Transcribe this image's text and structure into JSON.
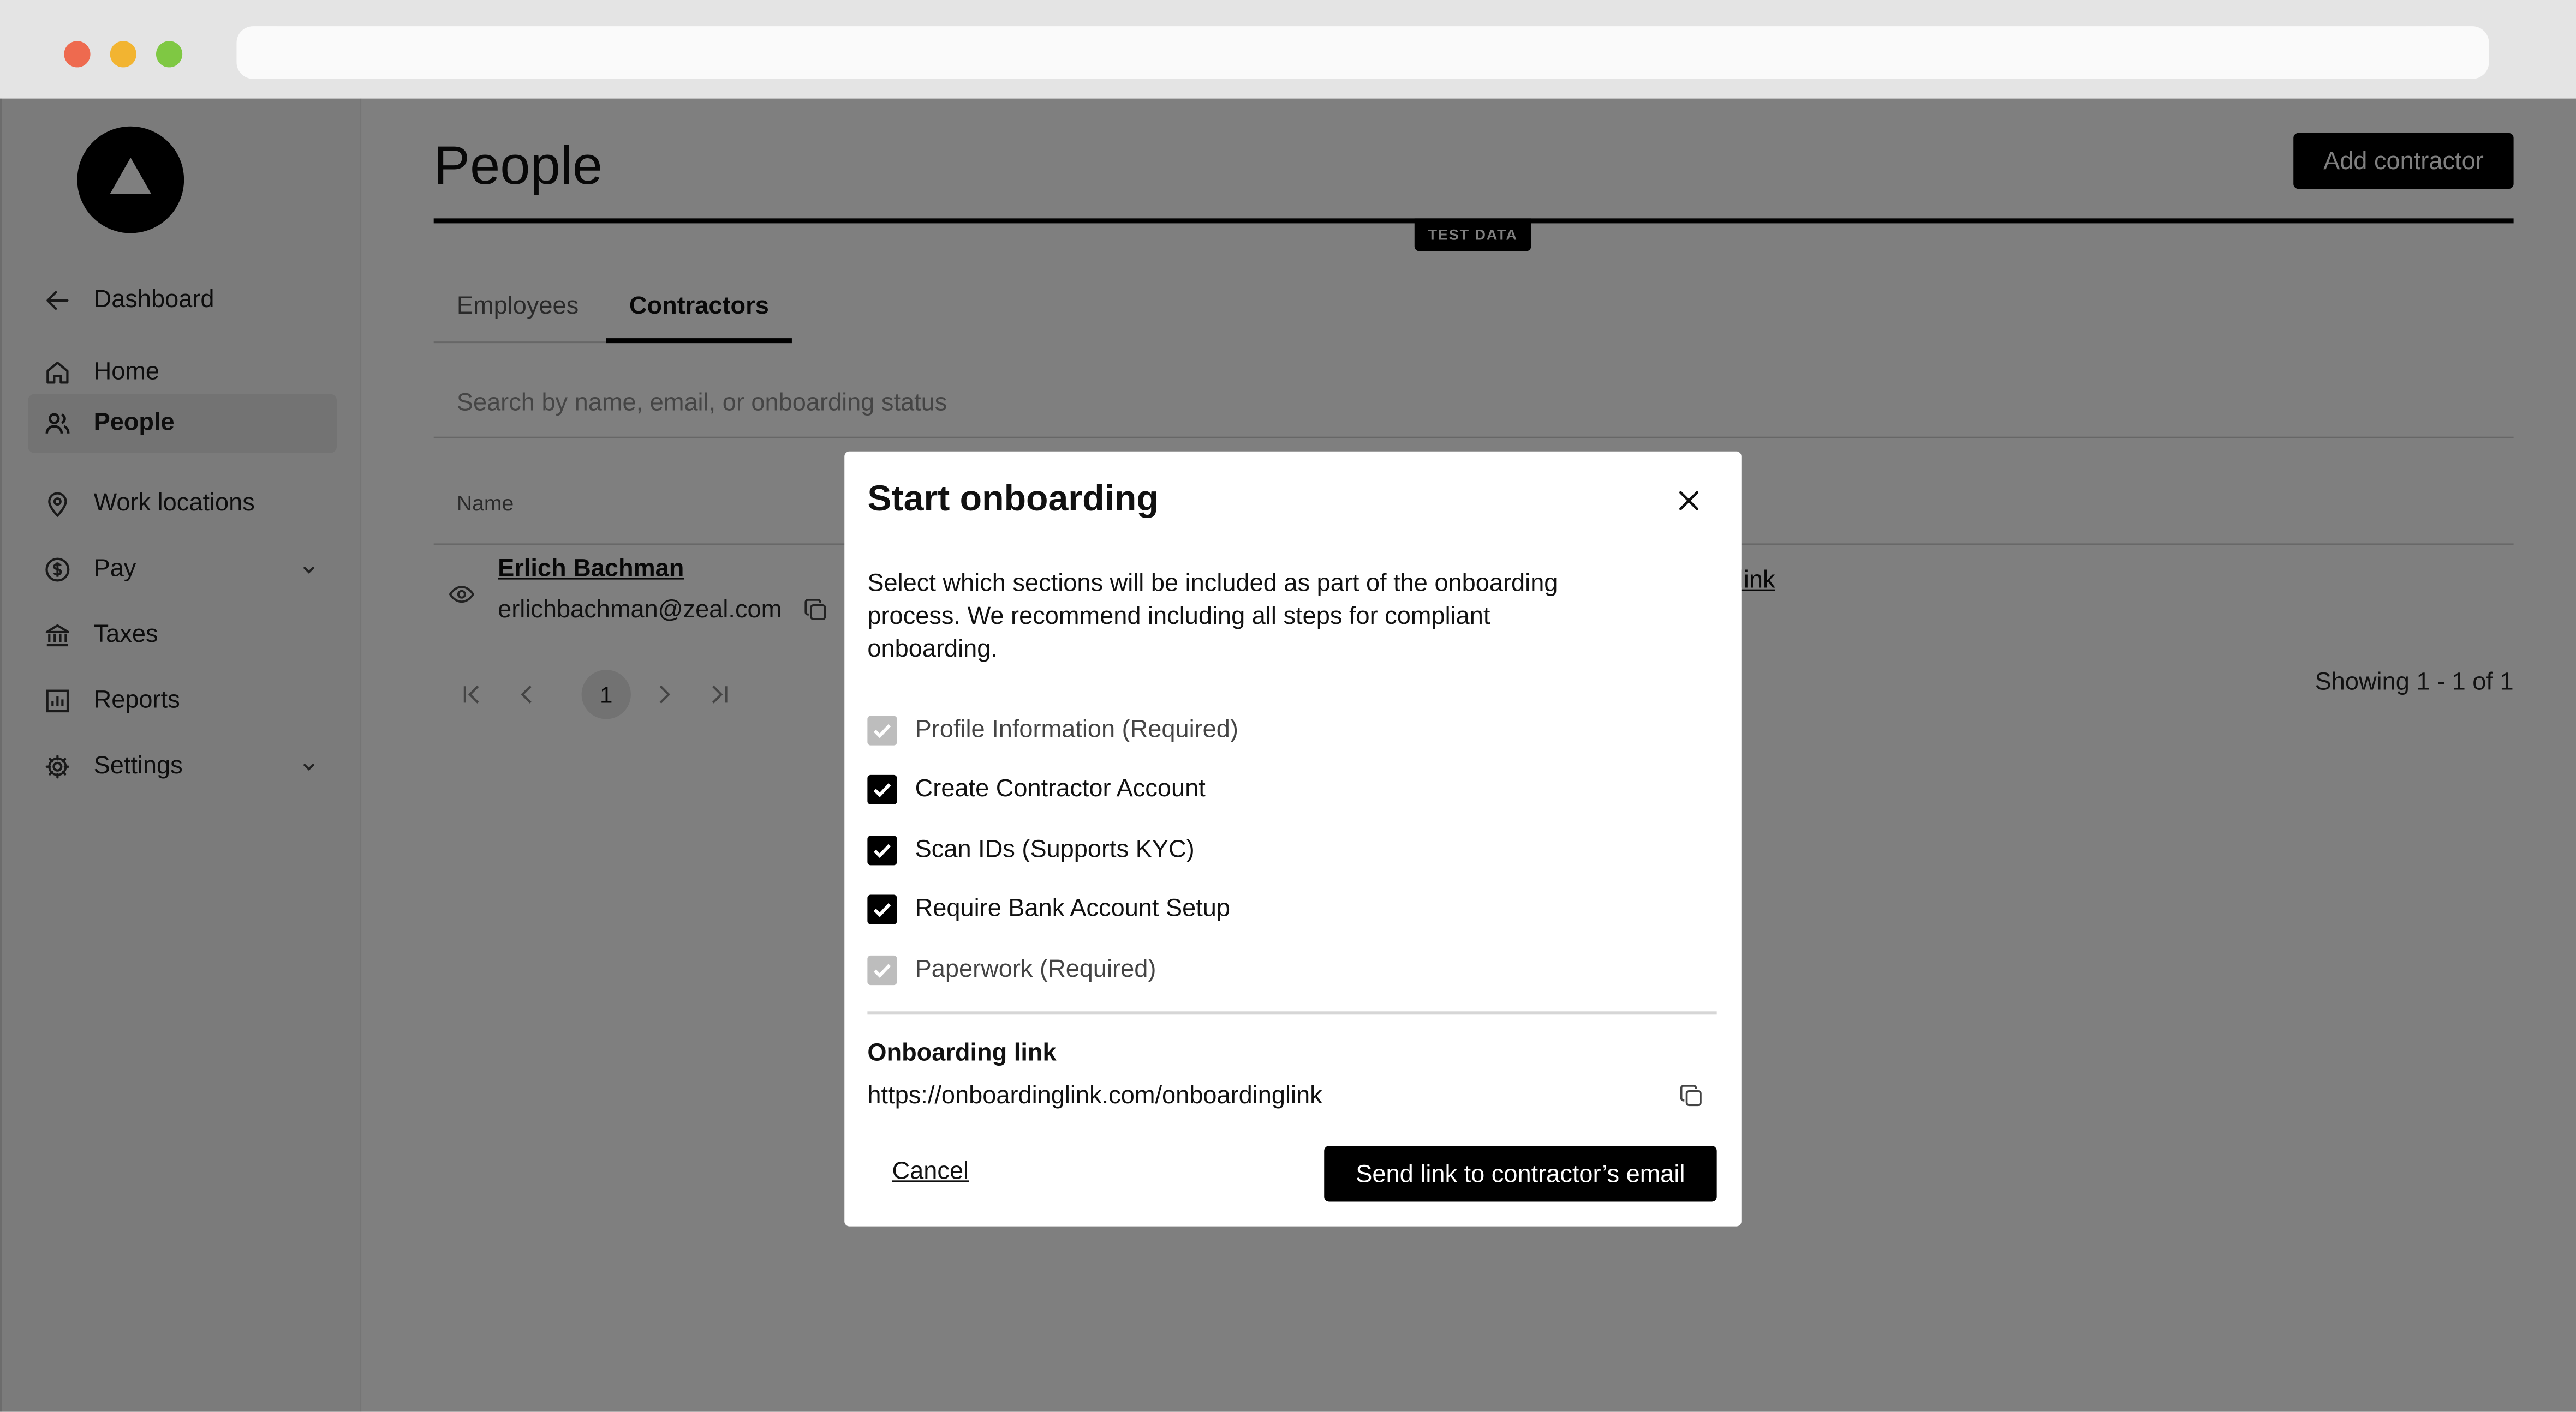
{
  "sidebar": {
    "items": [
      {
        "label": "Dashboard",
        "icon": "arrow-left-icon"
      },
      {
        "label": "Home",
        "icon": "home-icon"
      },
      {
        "label": "People",
        "icon": "people-icon",
        "active": true
      },
      {
        "label": "Work locations",
        "icon": "location-pin-icon"
      },
      {
        "label": "Pay",
        "icon": "dollar-circle-icon",
        "expandable": true
      },
      {
        "label": "Taxes",
        "icon": "bank-icon"
      },
      {
        "label": "Reports",
        "icon": "chart-icon"
      },
      {
        "label": "Settings",
        "icon": "gear-icon",
        "expandable": true
      }
    ]
  },
  "header": {
    "title": "People",
    "add_button": "Add contractor",
    "badge": "TEST DATA"
  },
  "tabs": [
    {
      "label": "Employees",
      "active": false
    },
    {
      "label": "Contractors",
      "active": true
    }
  ],
  "search": {
    "placeholder": "Search by name, email, or onboarding status"
  },
  "table": {
    "column_name": "Name",
    "rows": [
      {
        "name": "Erlich Bachman",
        "email": "erlichbachman@zeal.com",
        "link_text": "link"
      }
    ]
  },
  "pagination": {
    "current_page": "1",
    "showing": "Showing 1 - 1 of 1"
  },
  "modal": {
    "title": "Start onboarding",
    "description": "Select which sections will be included as part of the onboarding process. We recommend including all steps for compliant onboarding.",
    "options": [
      {
        "label": "Profile Information (Required)",
        "checked": true,
        "disabled": true
      },
      {
        "label": "Create Contractor Account",
        "checked": true,
        "disabled": false
      },
      {
        "label": "Scan IDs (Supports KYC)",
        "checked": true,
        "disabled": false
      },
      {
        "label": "Require Bank Account Setup",
        "checked": true,
        "disabled": false
      },
      {
        "label": "Paperwork (Required)",
        "checked": true,
        "disabled": true
      }
    ],
    "link_heading": "Onboarding link",
    "link_url": "https://onboardinglink.com/onboardinglink",
    "cancel_label": "Cancel",
    "send_label": "Send link to contractor’s email"
  },
  "colors": {
    "accent": "#000000",
    "overlay": "#808080",
    "traffic_red": "#ee6a4f",
    "traffic_yellow": "#f2b431",
    "traffic_green": "#7fc843"
  }
}
